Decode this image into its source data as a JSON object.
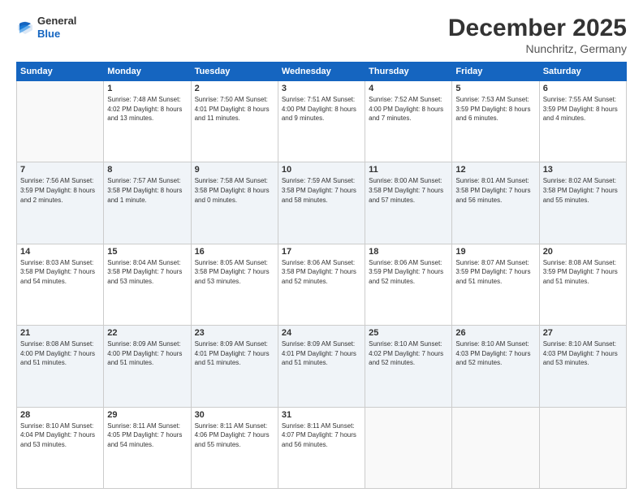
{
  "header": {
    "logo_general": "General",
    "logo_blue": "Blue",
    "month_title": "December 2025",
    "location": "Nunchritz, Germany"
  },
  "weekdays": [
    "Sunday",
    "Monday",
    "Tuesday",
    "Wednesday",
    "Thursday",
    "Friday",
    "Saturday"
  ],
  "weeks": [
    [
      {
        "day": "",
        "info": ""
      },
      {
        "day": "1",
        "info": "Sunrise: 7:48 AM\nSunset: 4:02 PM\nDaylight: 8 hours\nand 13 minutes."
      },
      {
        "day": "2",
        "info": "Sunrise: 7:50 AM\nSunset: 4:01 PM\nDaylight: 8 hours\nand 11 minutes."
      },
      {
        "day": "3",
        "info": "Sunrise: 7:51 AM\nSunset: 4:00 PM\nDaylight: 8 hours\nand 9 minutes."
      },
      {
        "day": "4",
        "info": "Sunrise: 7:52 AM\nSunset: 4:00 PM\nDaylight: 8 hours\nand 7 minutes."
      },
      {
        "day": "5",
        "info": "Sunrise: 7:53 AM\nSunset: 3:59 PM\nDaylight: 8 hours\nand 6 minutes."
      },
      {
        "day": "6",
        "info": "Sunrise: 7:55 AM\nSunset: 3:59 PM\nDaylight: 8 hours\nand 4 minutes."
      }
    ],
    [
      {
        "day": "7",
        "info": "Sunrise: 7:56 AM\nSunset: 3:59 PM\nDaylight: 8 hours\nand 2 minutes."
      },
      {
        "day": "8",
        "info": "Sunrise: 7:57 AM\nSunset: 3:58 PM\nDaylight: 8 hours\nand 1 minute."
      },
      {
        "day": "9",
        "info": "Sunrise: 7:58 AM\nSunset: 3:58 PM\nDaylight: 8 hours\nand 0 minutes."
      },
      {
        "day": "10",
        "info": "Sunrise: 7:59 AM\nSunset: 3:58 PM\nDaylight: 7 hours\nand 58 minutes."
      },
      {
        "day": "11",
        "info": "Sunrise: 8:00 AM\nSunset: 3:58 PM\nDaylight: 7 hours\nand 57 minutes."
      },
      {
        "day": "12",
        "info": "Sunrise: 8:01 AM\nSunset: 3:58 PM\nDaylight: 7 hours\nand 56 minutes."
      },
      {
        "day": "13",
        "info": "Sunrise: 8:02 AM\nSunset: 3:58 PM\nDaylight: 7 hours\nand 55 minutes."
      }
    ],
    [
      {
        "day": "14",
        "info": "Sunrise: 8:03 AM\nSunset: 3:58 PM\nDaylight: 7 hours\nand 54 minutes."
      },
      {
        "day": "15",
        "info": "Sunrise: 8:04 AM\nSunset: 3:58 PM\nDaylight: 7 hours\nand 53 minutes."
      },
      {
        "day": "16",
        "info": "Sunrise: 8:05 AM\nSunset: 3:58 PM\nDaylight: 7 hours\nand 53 minutes."
      },
      {
        "day": "17",
        "info": "Sunrise: 8:06 AM\nSunset: 3:58 PM\nDaylight: 7 hours\nand 52 minutes."
      },
      {
        "day": "18",
        "info": "Sunrise: 8:06 AM\nSunset: 3:59 PM\nDaylight: 7 hours\nand 52 minutes."
      },
      {
        "day": "19",
        "info": "Sunrise: 8:07 AM\nSunset: 3:59 PM\nDaylight: 7 hours\nand 51 minutes."
      },
      {
        "day": "20",
        "info": "Sunrise: 8:08 AM\nSunset: 3:59 PM\nDaylight: 7 hours\nand 51 minutes."
      }
    ],
    [
      {
        "day": "21",
        "info": "Sunrise: 8:08 AM\nSunset: 4:00 PM\nDaylight: 7 hours\nand 51 minutes."
      },
      {
        "day": "22",
        "info": "Sunrise: 8:09 AM\nSunset: 4:00 PM\nDaylight: 7 hours\nand 51 minutes."
      },
      {
        "day": "23",
        "info": "Sunrise: 8:09 AM\nSunset: 4:01 PM\nDaylight: 7 hours\nand 51 minutes."
      },
      {
        "day": "24",
        "info": "Sunrise: 8:09 AM\nSunset: 4:01 PM\nDaylight: 7 hours\nand 51 minutes."
      },
      {
        "day": "25",
        "info": "Sunrise: 8:10 AM\nSunset: 4:02 PM\nDaylight: 7 hours\nand 52 minutes."
      },
      {
        "day": "26",
        "info": "Sunrise: 8:10 AM\nSunset: 4:03 PM\nDaylight: 7 hours\nand 52 minutes."
      },
      {
        "day": "27",
        "info": "Sunrise: 8:10 AM\nSunset: 4:03 PM\nDaylight: 7 hours\nand 53 minutes."
      }
    ],
    [
      {
        "day": "28",
        "info": "Sunrise: 8:10 AM\nSunset: 4:04 PM\nDaylight: 7 hours\nand 53 minutes."
      },
      {
        "day": "29",
        "info": "Sunrise: 8:11 AM\nSunset: 4:05 PM\nDaylight: 7 hours\nand 54 minutes."
      },
      {
        "day": "30",
        "info": "Sunrise: 8:11 AM\nSunset: 4:06 PM\nDaylight: 7 hours\nand 55 minutes."
      },
      {
        "day": "31",
        "info": "Sunrise: 8:11 AM\nSunset: 4:07 PM\nDaylight: 7 hours\nand 56 minutes."
      },
      {
        "day": "",
        "info": ""
      },
      {
        "day": "",
        "info": ""
      },
      {
        "day": "",
        "info": ""
      }
    ]
  ]
}
